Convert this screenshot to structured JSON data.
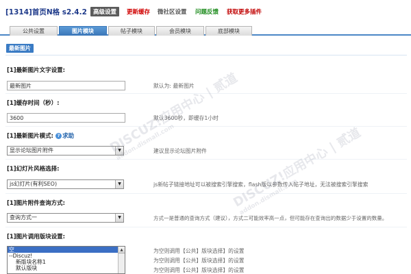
{
  "header": {
    "title": "[1314]首页N格 s2.4.2",
    "links": [
      {
        "label": "高级设置",
        "style": "active"
      },
      {
        "label": "更新缓存",
        "style": "red"
      },
      {
        "label": "微社区设置",
        "style": "gray"
      },
      {
        "label": "问题反馈",
        "style": "green"
      },
      {
        "label": "获取更多插件",
        "style": "red2"
      }
    ]
  },
  "tabs": [
    {
      "label": "公共设置"
    },
    {
      "label": "图片模块",
      "active": true
    },
    {
      "label": "帖子模块"
    },
    {
      "label": "会员模块"
    },
    {
      "label": "底部模块"
    }
  ],
  "section": {
    "title": "最新图片"
  },
  "fields": {
    "text_setting": {
      "label": "[1]最新图片文字设置:",
      "value": "最新图片",
      "hint": "默认为: 最新图片"
    },
    "cache_time": {
      "label": "[1]缓存时间（秒）:",
      "value": "3600",
      "hint": "默认3600秒，即缓存1小时"
    },
    "mode": {
      "label": "[1]最新图片模式:",
      "help": "求助",
      "value": "显示论坛图片附件",
      "hint": "建议显示论坛图片附件"
    },
    "slideshow": {
      "label": "[1]幻灯片风格选择:",
      "value": "js幻灯片(有利SEO)",
      "hint": "js新帖子链接地址可以被搜索引擎搜索，flash版以参数传入帖子地址，无法被搜索引擎搜索"
    },
    "query": {
      "label": "[1]图片附件查询方式:",
      "value": "查询方式一",
      "hint": "方式一是普通的查询方式（建议），方式二可能效率高一点，但可能存在查询出的数据少于设置的数量。"
    },
    "block": {
      "label": "[1]图片调用版块设置:",
      "options": [
        "空",
        "--Discuz!",
        "新版块名称1",
        "默认版块"
      ],
      "hints": [
        "为空则调用【公共】版块选择】的设置",
        "为空则调用【公共】版块选择】的设置",
        "为空则调用【公共】版块选择】的设置"
      ]
    }
  },
  "watermark": {
    "main": "DISCUZ!应用中心 | 贰道",
    "sub": "addon.dismall.com"
  }
}
